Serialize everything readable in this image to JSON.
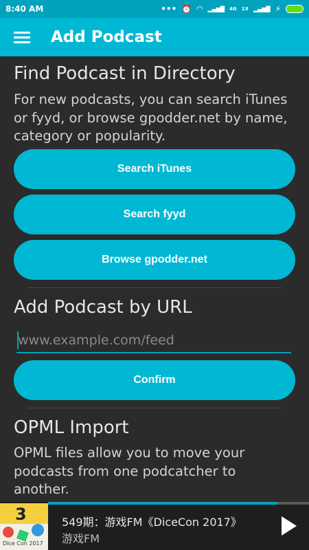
{
  "status_bar": {
    "time": "8:40 AM",
    "network_labels": [
      "4G",
      "1X"
    ]
  },
  "app_bar": {
    "title": "Add Podcast"
  },
  "directory": {
    "title": "Find Podcast in Directory",
    "description": "For new podcasts, you can search iTunes or fyyd, or browse gpodder.net by name, category or popularity.",
    "buttons": [
      "Search iTunes",
      "Search fyyd",
      "Browse gpodder.net"
    ]
  },
  "url_section": {
    "title": "Add Podcast by URL",
    "placeholder": "www.example.com/feed",
    "value": "",
    "confirm_label": "Confirm"
  },
  "opml": {
    "title": "OPML Import",
    "description": "OPML files allow you to move your podcasts from one podcatcher to another."
  },
  "player": {
    "episode_title": "549期：游戏FM《DiceCon 2017》",
    "podcast_name": "游戏FM",
    "cover_text": "Dice Con 2017",
    "cover_number": "3",
    "progress": 0.88
  },
  "colors": {
    "accent": "#00b8d4",
    "status_bar": "#00a2bd",
    "background": "#2b2b2b"
  }
}
